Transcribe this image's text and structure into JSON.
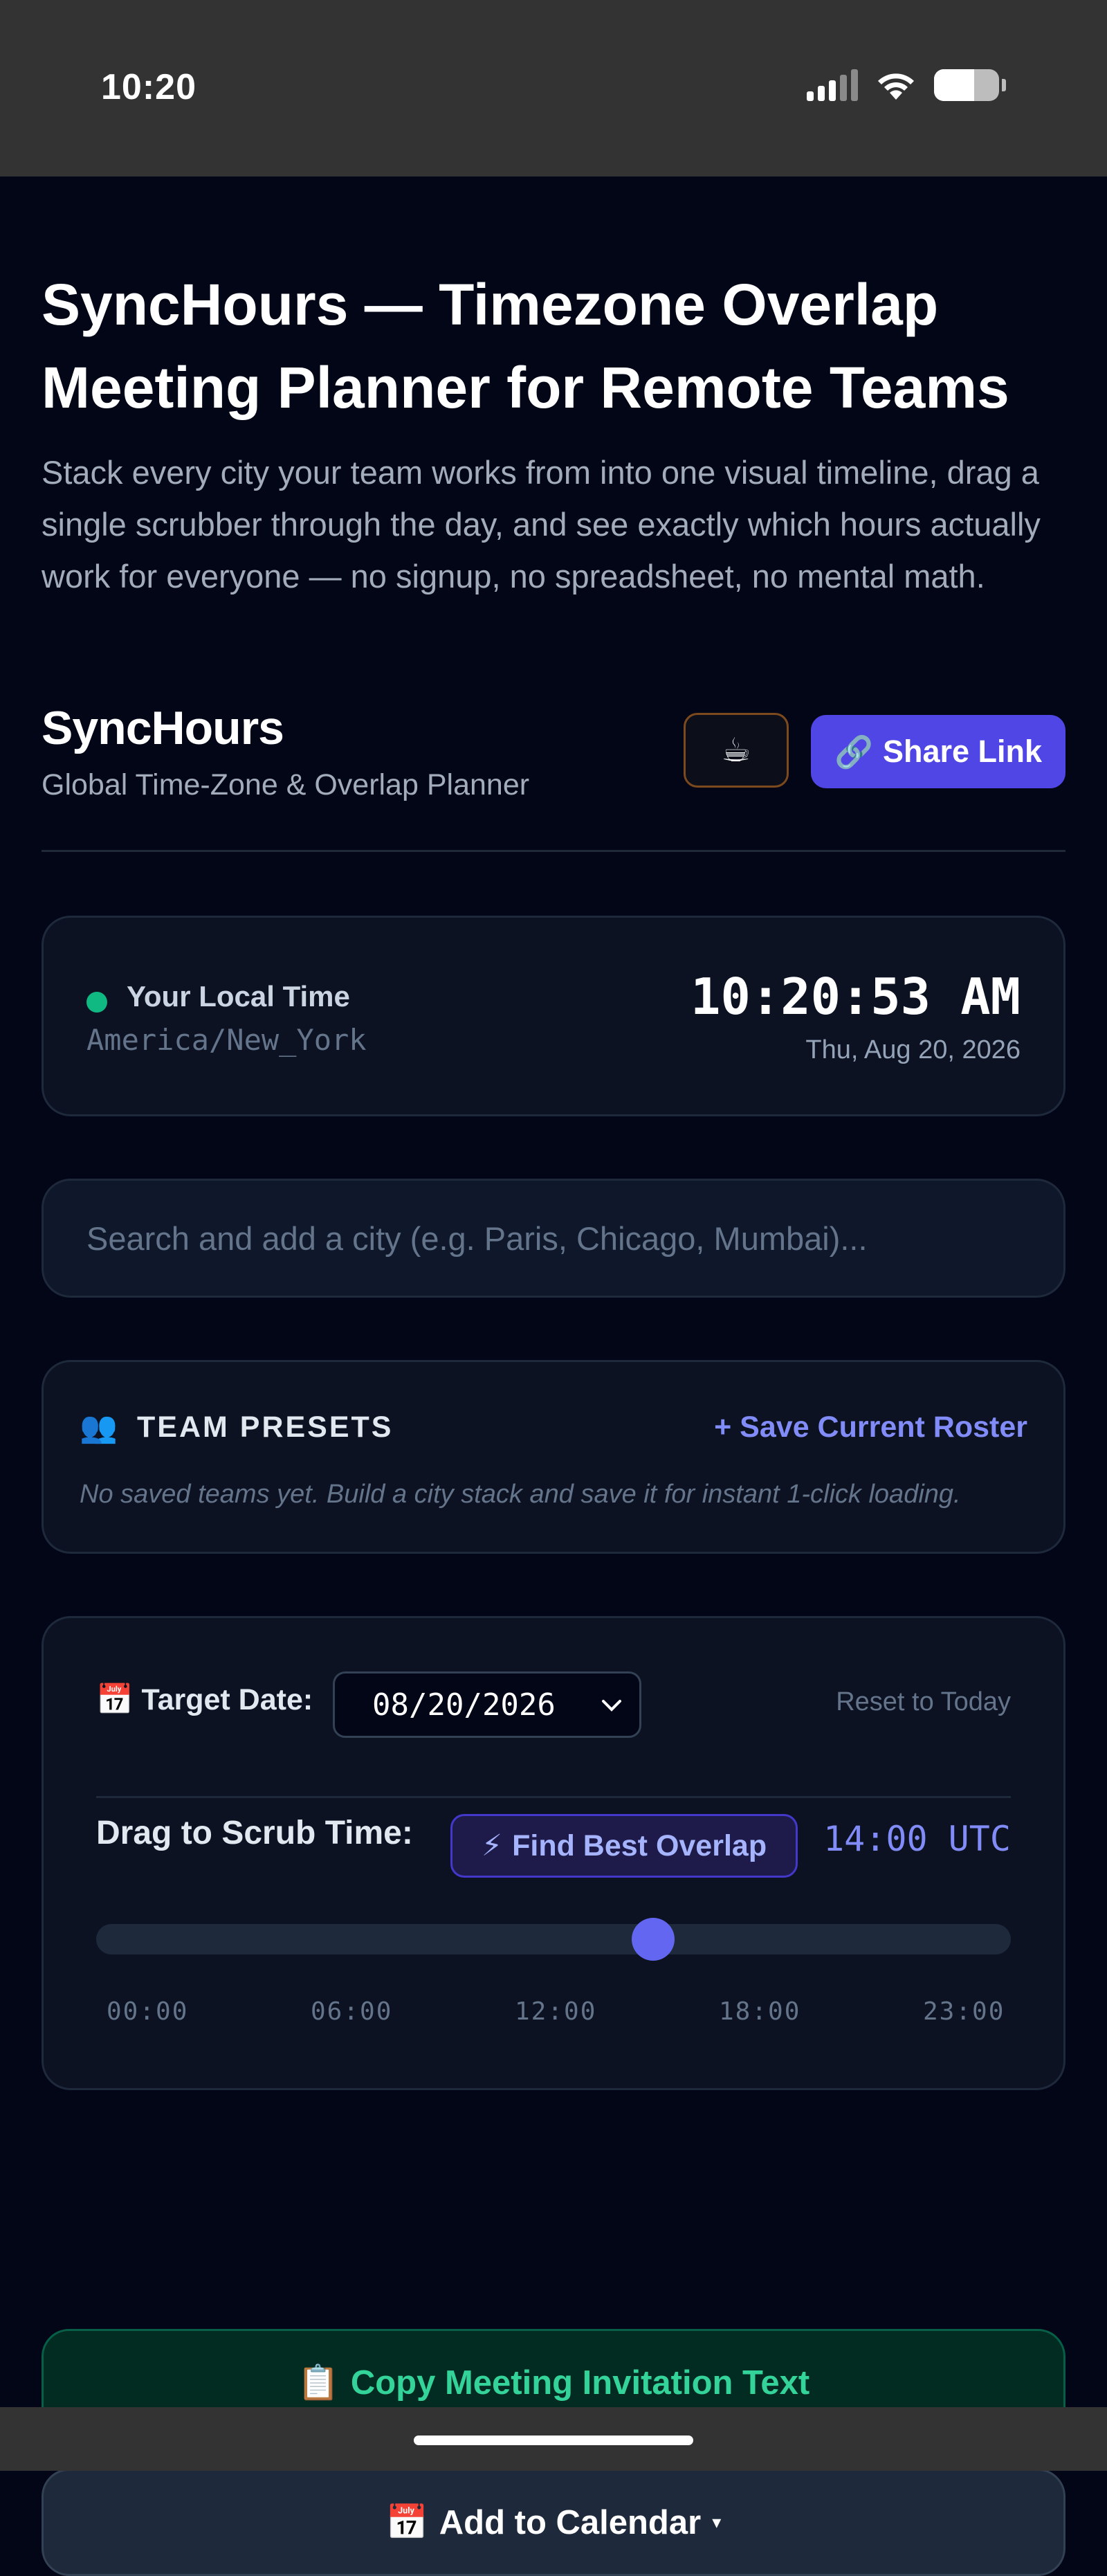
{
  "status_bar": {
    "time": "10:20",
    "battery_level": 0.62
  },
  "hero": {
    "title": "SyncHours — Timezone Overlap Meeting Planner for Remote Teams",
    "subtitle": "Stack every city your team works from into one visual timeline, drag a single scrubber through the day, and see exactly which hours actually work for everyone — no signup, no spreadsheet, no mental math."
  },
  "header": {
    "brand": "SyncHours",
    "tagline": "Global Time-Zone & Overlap Planner",
    "coffee_icon": "☕",
    "share_icon": "🔗",
    "share_label": "Share Link"
  },
  "local_time": {
    "label": "Your Local Time",
    "zone": "America/New_York",
    "clock": "10:20:53 AM",
    "date": "Thu, Aug 20, 2026",
    "status_color": "#10b981"
  },
  "search": {
    "placeholder": "Search and add a city (e.g. Paris, Chicago, Mumbai)...",
    "value": ""
  },
  "presets": {
    "icon": "👥",
    "title": "TEAM PRESETS",
    "save_label": "+ Save Current Roster",
    "empty_text": "No saved teams yet. Build a city stack and save it for instant 1-click loading."
  },
  "scrubber": {
    "date_icon": "📅",
    "date_label": "Target Date:",
    "date_value": "08/20/2026",
    "reset_label": "Reset to Today",
    "scrub_label": "Drag to Scrub Time:",
    "overlap_icon": "⚡",
    "overlap_label": "Find Best Overlap",
    "utc_readout": "14:00 UTC",
    "value_hour": 14,
    "range": [
      0,
      23
    ],
    "ticks": [
      "00:00",
      "06:00",
      "12:00",
      "18:00",
      "23:00"
    ],
    "accent_color": "#6366f1"
  },
  "actions": {
    "copy_icon": "📋",
    "copy_label": "Copy Meeting Invitation Text",
    "calendar_icon": "📅",
    "calendar_label": "Add to Calendar",
    "calendar_caret": "▾"
  }
}
